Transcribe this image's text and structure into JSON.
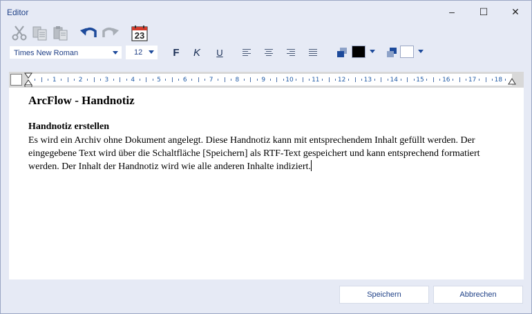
{
  "window": {
    "title": "Editor"
  },
  "titlebar": {
    "minimize": "–",
    "maximize": "☐",
    "close": "✕"
  },
  "toolbar": {
    "icons": [
      "scissors-icon",
      "copy-icon",
      "paste-icon",
      "undo-icon",
      "redo-icon",
      "calendar-icon"
    ],
    "calendar_day": "23"
  },
  "format": {
    "font": "Times New Roman",
    "size": "12",
    "bold": "F",
    "italic": "K",
    "underline": "U",
    "text_color": "#000000",
    "background_color": "#ffffff"
  },
  "ruler": {
    "numbers": [
      "1",
      "2",
      "3",
      "4",
      "5",
      "6",
      "7",
      "8",
      "9",
      "10",
      "11",
      "12",
      "13",
      "14",
      "15",
      "16",
      "17",
      "18"
    ]
  },
  "document": {
    "title": "ArcFlow - Handnotiz",
    "heading": "Handnotiz erstellen",
    "body": "Es wird ein Archiv ohne Dokument angelegt. Diese Handnotiz kann mit entsprechendem Inhalt gefüllt werden. Der eingegebene Text wird über die Schaltfläche [Speichern] als RTF-Text gespeichert und kann entsprechend formatiert werden. Der Inhalt der Handnotiz wird wie alle anderen Inhalte indiziert."
  },
  "buttons": {
    "save": "Speichern",
    "cancel": "Abbrechen"
  },
  "colors": {
    "accent": "#1d4a9b",
    "title_text": "#1d3f86",
    "window_bg": "#e6eaf5"
  }
}
